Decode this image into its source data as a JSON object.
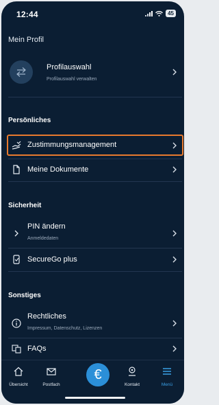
{
  "status": {
    "time": "12:44",
    "battery": "45"
  },
  "page": {
    "title": "Mein Profil"
  },
  "profile": {
    "label": "Profilauswahl",
    "sub": "Profilauswahl verwalten"
  },
  "sections": {
    "personal": {
      "title": "Persönliches",
      "items": [
        {
          "label": "Zustimmungsmanagement",
          "icon": "consent-hand-icon"
        },
        {
          "label": "Meine Dokumente",
          "icon": "document-icon"
        }
      ]
    },
    "security": {
      "title": "Sicherheit",
      "items": [
        {
          "label": "PIN ändern",
          "sub": "Anmeldedaten",
          "icon": "chevron-right-icon"
        },
        {
          "label": "SecureGo plus",
          "icon": "secure-phone-icon"
        }
      ]
    },
    "other": {
      "title": "Sonstiges",
      "items": [
        {
          "label": "Rechtliches",
          "sub": "Impressum, Datenschutz, Lizenzen",
          "icon": "info-icon"
        },
        {
          "label": "FAQs",
          "icon": "faq-icon"
        }
      ]
    }
  },
  "tabs": [
    {
      "label": "Übersicht",
      "icon": "home-icon"
    },
    {
      "label": "Postfach",
      "icon": "mail-icon"
    },
    {
      "label": "€",
      "icon": "euro-icon"
    },
    {
      "label": "Kontakt",
      "icon": "contact-icon"
    },
    {
      "label": "Menü",
      "icon": "menu-icon",
      "active": true
    }
  ],
  "colors": {
    "background": "#0b1e33",
    "accent": "#2b8fd8",
    "highlight": "#e87a2e",
    "active_tab": "#3aa0e6"
  }
}
